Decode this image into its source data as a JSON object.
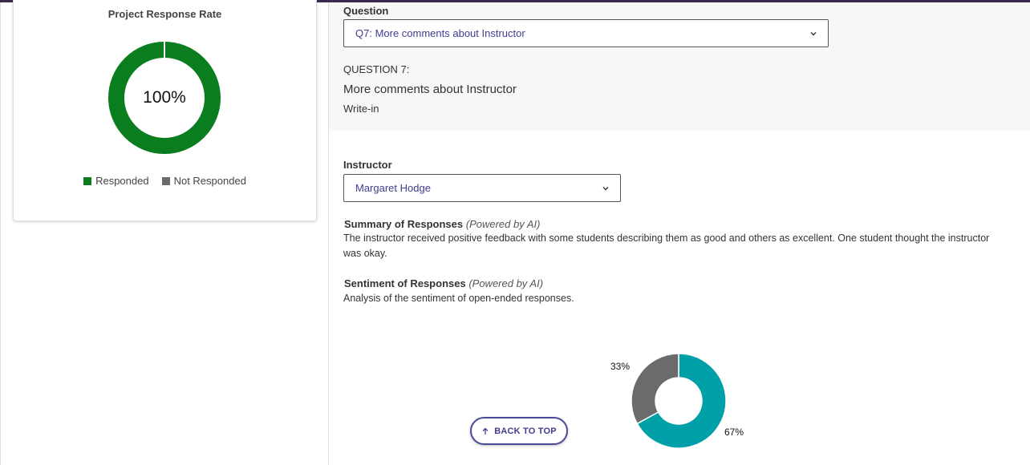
{
  "response_card": {
    "title": "Project Response Rate",
    "center_label": "100%",
    "responded_fraction": 1.0,
    "legend": [
      {
        "label": "Responded",
        "color": "#0a7d1e"
      },
      {
        "label": "Not Responded",
        "color": "#6b6b6b"
      }
    ]
  },
  "question_panel": {
    "label": "Question",
    "selected": "Q7: More comments about Instructor",
    "number_label": "QUESTION 7:",
    "text": "More comments about Instructor",
    "type": "Write-in"
  },
  "instructor": {
    "label": "Instructor",
    "selected": "Margaret Hodge"
  },
  "summary": {
    "title": "Summary of Responses",
    "powered": "(Powered by AI)",
    "text": "The instructor received positive feedback with some students describing them as good and others as excellent. One student thought the instructor was okay."
  },
  "sentiment": {
    "title": "Sentiment of Responses",
    "powered": "(Powered by AI)",
    "text": "Analysis of the sentiment of open-ended responses."
  },
  "chart_data": {
    "type": "pie",
    "values": [
      67,
      33
    ],
    "labels": [
      "67%",
      "33%"
    ],
    "colors": [
      "#00a0a8",
      "#6b6b6b"
    ],
    "donut": true
  },
  "back_to_top": {
    "label": "BACK TO TOP",
    "icon": "arrow-up-icon"
  }
}
